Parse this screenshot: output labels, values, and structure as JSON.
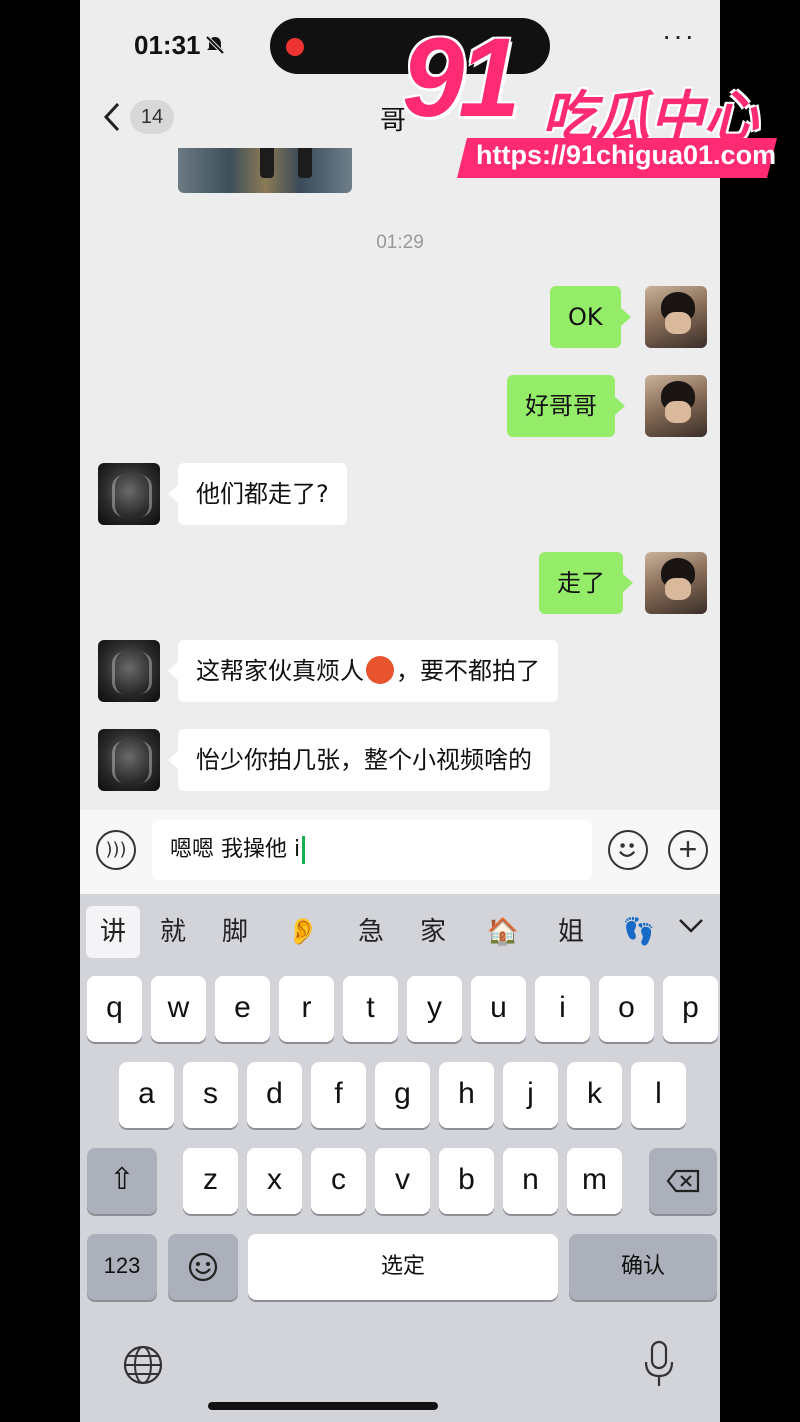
{
  "status": {
    "time": "01:31"
  },
  "nav": {
    "unread_badge": "14",
    "title": "哥"
  },
  "chat": {
    "timestamp": "01:29",
    "messages": [
      {
        "sender": "me",
        "text": "OK"
      },
      {
        "sender": "me",
        "text": "好哥哥"
      },
      {
        "sender": "them",
        "text": "他们都走了?"
      },
      {
        "sender": "me",
        "text": "走了"
      },
      {
        "sender": "them",
        "text_before_emoji": "这帮家伙真烦人",
        "emoji": "angry-face",
        "text_after_emoji": "，要不都拍了"
      },
      {
        "sender": "them",
        "text": "怡少你拍几张，整个小视频啥的"
      }
    ]
  },
  "input": {
    "value": "嗯嗯 我操他 i"
  },
  "keyboard": {
    "candidates": [
      "讲",
      "就",
      "脚",
      "👂",
      "急",
      "家",
      "🏠",
      "姐",
      "👣"
    ],
    "row1": [
      "q",
      "w",
      "e",
      "r",
      "t",
      "y",
      "u",
      "i",
      "o",
      "p"
    ],
    "row2": [
      "a",
      "s",
      "d",
      "f",
      "g",
      "h",
      "j",
      "k",
      "l"
    ],
    "row3": [
      "z",
      "x",
      "c",
      "v",
      "b",
      "n",
      "m"
    ],
    "shift": "⇧",
    "numbers": "123",
    "space": "选定",
    "confirm": "确认"
  },
  "watermark": {
    "logo": "91",
    "text": "吃瓜中心",
    "url": "https://91chigua01.com"
  },
  "colors": {
    "my_bubble": "#95ec69",
    "their_bubble": "#ffffff",
    "watermark": "#ff2a74",
    "background": "#ededed"
  }
}
